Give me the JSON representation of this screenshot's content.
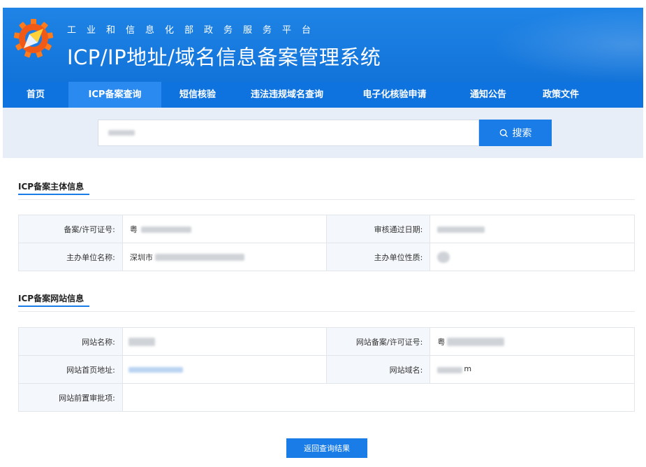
{
  "header": {
    "subtitle": "工业和信息化部政务服务平台",
    "title": "ICP/IP地址/域名信息备案管理系统"
  },
  "nav": {
    "items": [
      {
        "label": "首页",
        "active": false
      },
      {
        "label": "ICP备案查询",
        "active": true
      },
      {
        "label": "短信核验",
        "active": false
      },
      {
        "label": "违法违规域名查询",
        "active": false
      },
      {
        "label": "电子化核验申请",
        "active": false
      },
      {
        "label": "通知公告",
        "active": false
      },
      {
        "label": "政策文件",
        "active": false
      }
    ]
  },
  "search": {
    "button_label": "搜索"
  },
  "subject_section": {
    "title": "ICP备案主体信息",
    "license_label": "备案/许可证号:",
    "license_value_prefix": "粤",
    "approval_date_label": "审核通过日期:",
    "unit_name_label": "主办单位名称:",
    "unit_name_value_prefix": "深圳市",
    "unit_nature_label": "主办单位性质:"
  },
  "website_section": {
    "title": "ICP备案网站信息",
    "site_name_label": "网站名称:",
    "site_license_label": "网站备案/许可证号:",
    "site_license_value_prefix": "粤",
    "homepage_label": "网站首页地址:",
    "domain_label": "网站域名:",
    "domain_value_suffix": "m",
    "preapproval_label": "网站前置审批项:",
    "preapproval_value": ""
  },
  "footer": {
    "back_button_label": "返回查询结果"
  },
  "colors": {
    "header_blue": "#1a7ce6",
    "nav_blue": "#0e73df",
    "nav_active": "#2b8aef",
    "band": "#e7eef8"
  }
}
